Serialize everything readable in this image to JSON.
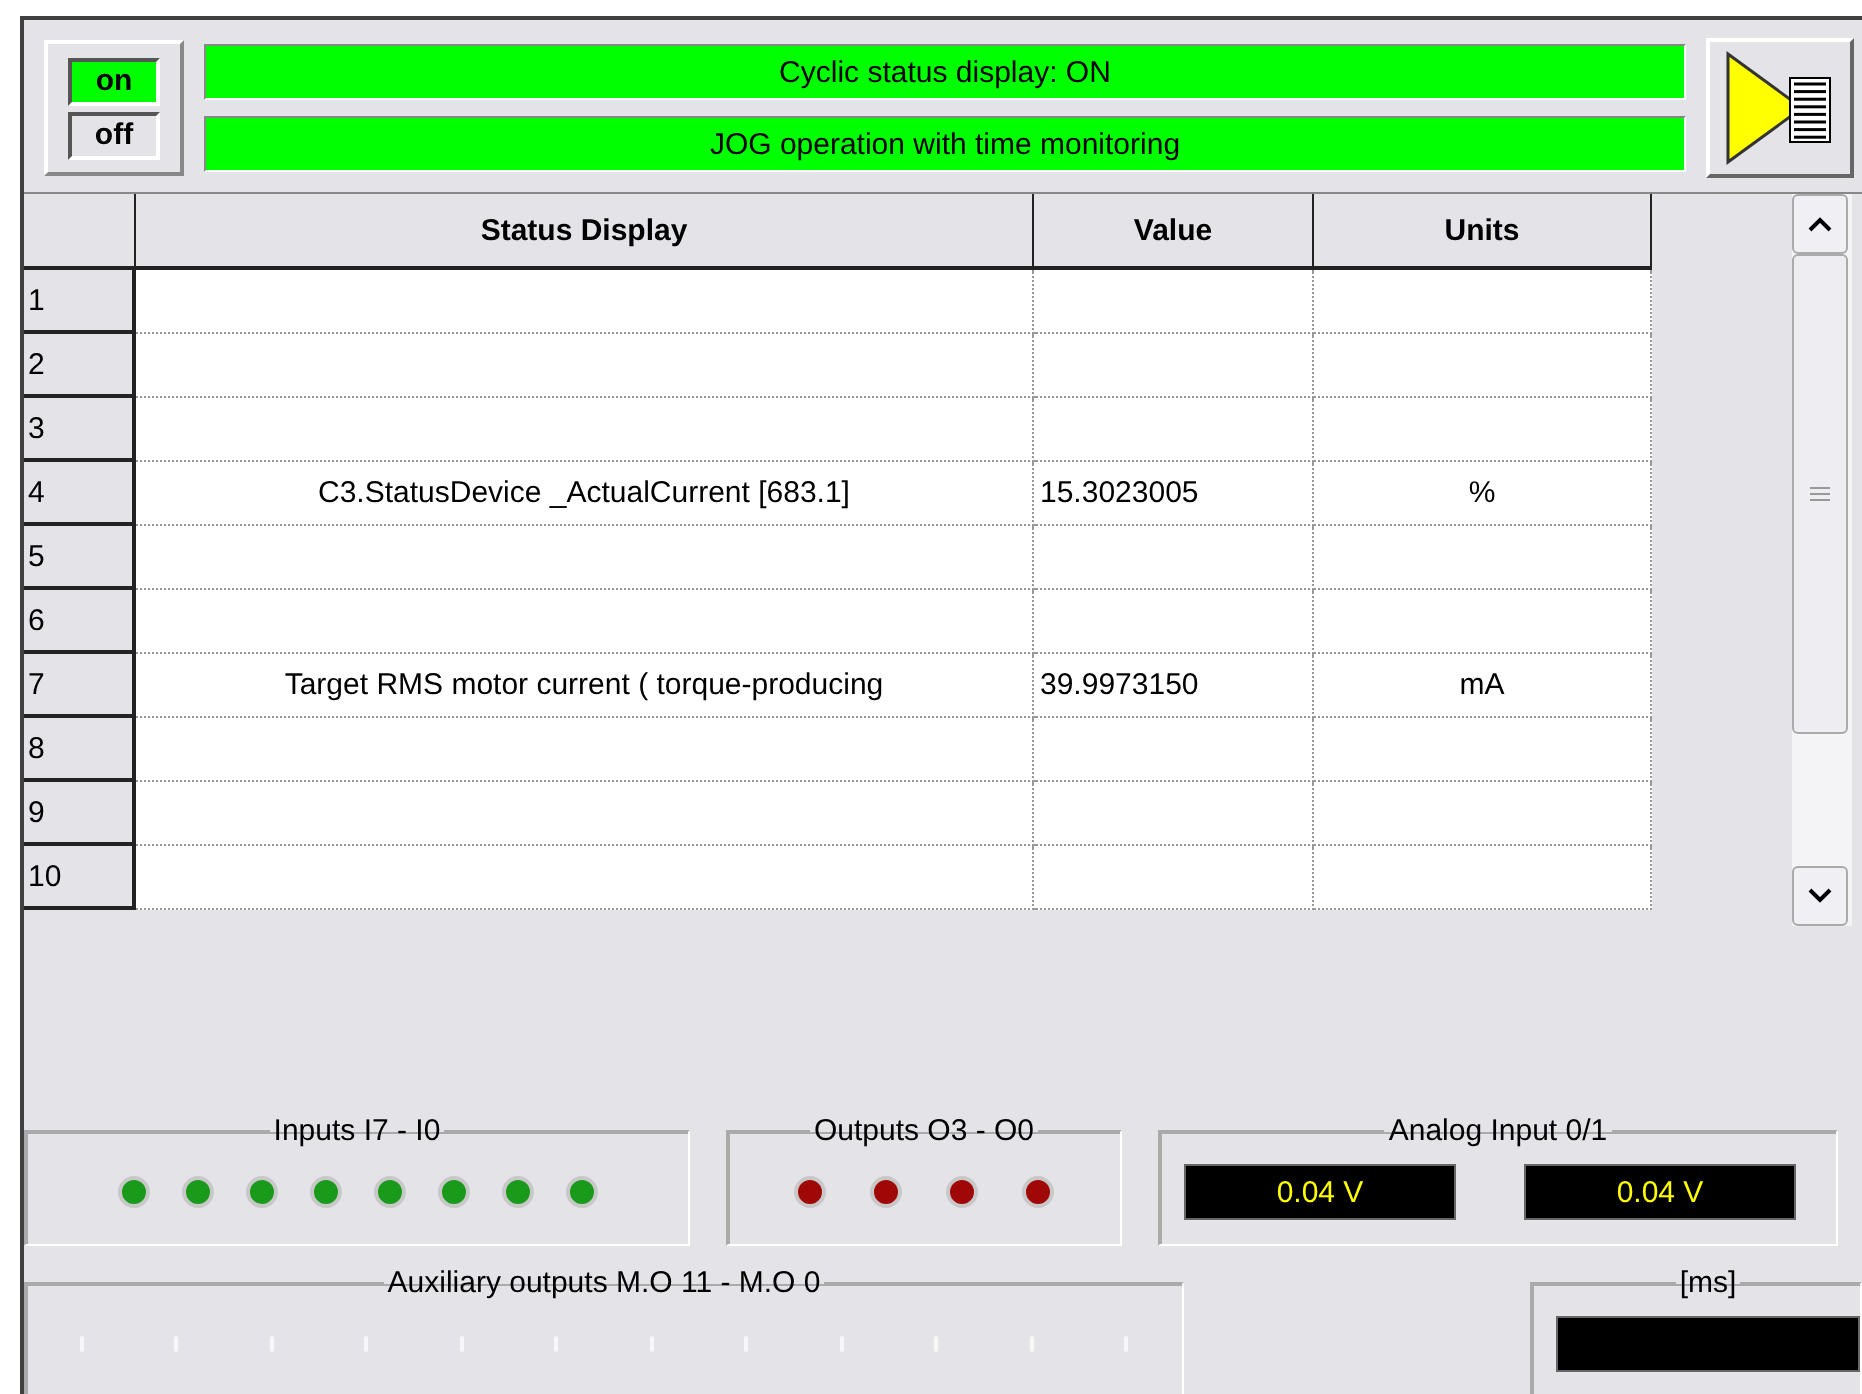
{
  "mode_switch": [
    {
      "label": "on",
      "selected": true
    },
    {
      "label": "off",
      "selected": false
    }
  ],
  "status_lines": [
    "Cyclic status display: ON",
    "JOG operation with time monitoring"
  ],
  "table": {
    "columns": [
      "Status Display",
      "Value",
      "Units"
    ],
    "rows": [
      {
        "number": "1"
      },
      {
        "number": "2"
      },
      {
        "number": "3"
      },
      {
        "number": "4",
        "status_display": "C3.StatusDevice _ActualCurrent [683.1]",
        "value": "15.3023005",
        "units": "%"
      },
      {
        "number": "5"
      },
      {
        "number": "6"
      },
      {
        "number": "7",
        "status_display": "Target RMS motor current ( torque-producing",
        "value": "39.9973150",
        "units": "mA"
      },
      {
        "number": "8"
      },
      {
        "number": "9"
      },
      {
        "number": "10"
      }
    ]
  },
  "inputs": {
    "title": "Inputs I7 - I0",
    "leds": [
      {
        "on": true
      },
      {
        "on": true
      },
      {
        "on": true
      },
      {
        "on": true
      },
      {
        "on": true
      },
      {
        "on": true
      },
      {
        "on": true
      },
      {
        "on": true
      }
    ]
  },
  "outputs": {
    "title": "Outputs O3 - O0",
    "leds": [
      {
        "on": true
      },
      {
        "on": true
      },
      {
        "on": true
      },
      {
        "on": true
      }
    ]
  },
  "analog_input": {
    "title": "Analog Input 0/1",
    "readings": [
      "0.04 V",
      "0.04 V"
    ]
  },
  "auxiliary_outputs": {
    "title": "Auxiliary outputs M.O 11 - M.O 0",
    "leds": [
      {
        "on": false
      },
      {
        "on": false
      },
      {
        "on": false
      },
      {
        "on": false
      },
      {
        "on": false
      },
      {
        "on": false
      },
      {
        "on": false
      },
      {
        "on": false
      },
      {
        "on": false
      },
      {
        "on": false
      },
      {
        "on": false
      },
      {
        "on": false
      }
    ]
  },
  "timer": {
    "title": "[ms]"
  }
}
